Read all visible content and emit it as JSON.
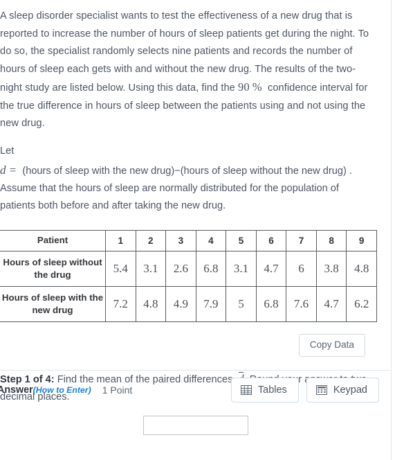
{
  "problem": {
    "paragraph_part1": "A sleep disorder specialist wants to test the effectiveness of a new drug that is reported to increase the number of hours of sleep patients get during the night. To do so, the specialist randomly selects nine patients and records the number of hours of sleep each gets with and without the new drug. The results of the two-night study are listed below. Using this data, find the",
    "confidence_level": "90 %",
    "paragraph_part2": "confidence interval for the true difference in hours of sleep between the patients using and not using the new drug.",
    "let_label": "Let",
    "definition_symbol": "d =",
    "definition_text": "(hours of sleep with the new drug)−(hours of sleep without the new drug) .",
    "assumption": "Assume that the hours of sleep are normally distributed for the population of patients both before and after taking the new drug."
  },
  "table": {
    "row_headers": [
      "Patient",
      "Hours of sleep without the drug",
      "Hours of sleep with the new drug"
    ],
    "patients": [
      "1",
      "2",
      "3",
      "4",
      "5",
      "6",
      "7",
      "8",
      "9"
    ],
    "without_drug": [
      "5.4",
      "3.1",
      "2.6",
      "6.8",
      "3.1",
      "4.7",
      "6",
      "3.8",
      "4.8"
    ],
    "with_drug": [
      "7.2",
      "4.8",
      "4.9",
      "7.9",
      "5",
      "6.8",
      "7.6",
      "4.7",
      "6.2"
    ]
  },
  "copy_data_button": {
    "label": "Copy Data"
  },
  "step": {
    "title": "Step 1 of 4:",
    "text_before_symbol": "Find the mean of the paired differences,",
    "symbol": "d",
    "text_after_symbol": ". Round your answer to two decimal places."
  },
  "answer_bar": {
    "label": "Answer",
    "how_to_enter": "(How to Enter)",
    "points": "1 Point",
    "tables_button": "Tables",
    "keypad_button": "Keypad"
  },
  "answer_input": {
    "value": "",
    "placeholder": ""
  },
  "colors": {
    "text": "#4b5563",
    "heading": "#2f3640",
    "link": "#1c7ed6",
    "table_border": "#56595c",
    "button_border": "#cfdce8",
    "divider": "#e2e5e9"
  }
}
